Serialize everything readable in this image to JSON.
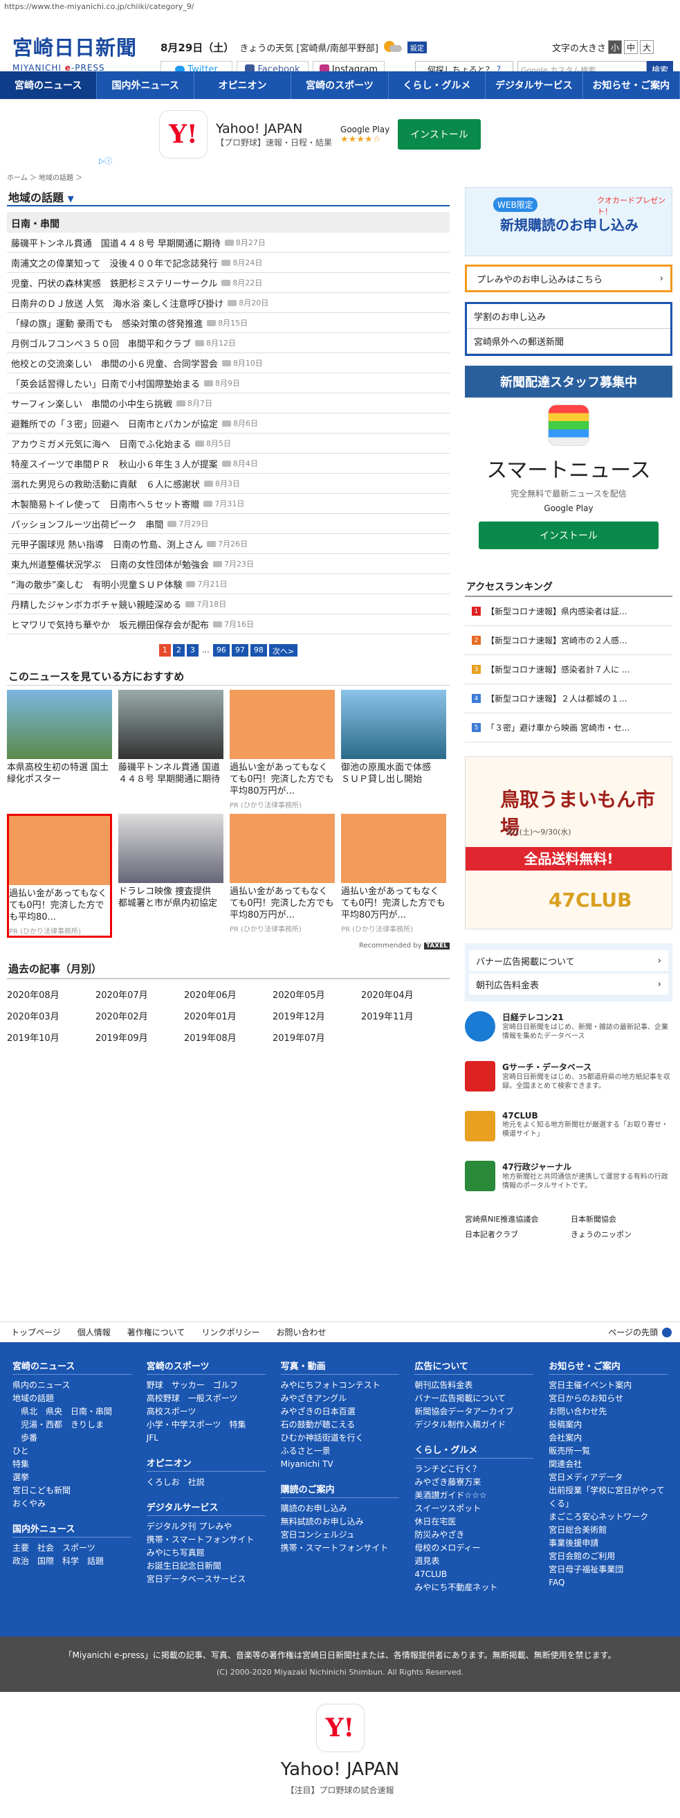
{
  "url": "https://www.the-miyanichi.co.jp/chiiki/category_9/",
  "header": {
    "logo_text": "宮崎日日新聞",
    "logo_sub_a": "MIYANICHI ",
    "logo_sub_b": "e",
    "logo_sub_c": "-PRESS",
    "date": "8月29日（土）",
    "weather_label": "きょうの天気 [宮崎県/南部平野部]",
    "weather_setting": "設定",
    "fontsize_label": "文字の大きさ",
    "fs_small": "小",
    "fs_mid": "中",
    "fs_large": "大",
    "twitter": "Twitter",
    "facebook": "Facebook",
    "instagram": "Instagram",
    "ask": "何探しちょると？",
    "search_placeholder": "Google カスタム検索",
    "search_button": "検索"
  },
  "nav": [
    "宮崎のニュース",
    "国内外ニュース",
    "オピニオン",
    "宮崎のスポーツ",
    "くらし・グルメ",
    "デジタルサービス",
    "お知らせ・ご案内"
  ],
  "top_ad": {
    "title": "Yahoo! JAPAN",
    "desc": "【プロ野球】速報・日程・結果",
    "gplay": "Google Play",
    "stars": "★★★★☆",
    "install": "インストール",
    "logo": "Y!"
  },
  "breadcrumb": "ホーム ＞ 地域の話題 ＞",
  "section_title": "地域の話題",
  "section_sub": "日南・串間",
  "articles": [
    {
      "title": "藤磯平トンネル貫通　国道４４８号 早期開通に期待",
      "date": "8月27日"
    },
    {
      "title": "南浦文之の偉業知って　没後４００年で記念誌発行",
      "date": "8月24日"
    },
    {
      "title": "児童、円状の森林実感　鉄肥杉ミステリーサークル",
      "date": "8月22日"
    },
    {
      "title": "日南弁のＤＪ放送 人気　海水浴 楽しく注意呼び掛け",
      "date": "8月20日"
    },
    {
      "title": "「緑の旗」運動 豪雨でも　感染対策の啓発推進",
      "date": "8月15日"
    },
    {
      "title": "月例ゴルフコンペ３５０回　串間平和クラブ",
      "date": "8月12日"
    },
    {
      "title": "他校との交流楽しい　串間の小６児童、合同学習会",
      "date": "8月10日"
    },
    {
      "title": "「英会話習得したい」日南で小村国際塾始まる",
      "date": "8月9日"
    },
    {
      "title": "サーフィン楽しい　串間の小中生ら挑戦",
      "date": "8月7日"
    },
    {
      "title": "避難所での「３密」回避へ　日南市とパカンが協定",
      "date": "8月6日"
    },
    {
      "title": "アカウミガメ元気に海へ　日南でふ化始まる",
      "date": "8月5日"
    },
    {
      "title": "特産スイーツで串間ＰＲ　秋山小６年生３人が提案",
      "date": "8月4日"
    },
    {
      "title": "溺れた男児らの救助活動に貢献　６人に感謝状",
      "date": "8月3日"
    },
    {
      "title": "木製簡易トイレ使って　日南市へ５セット寄贈",
      "date": "7月31日"
    },
    {
      "title": "パッションフルーツ出荷ピーク　串間",
      "date": "7月29日"
    },
    {
      "title": "元甲子園球児 熱い指導　日南の竹島、渕上さん",
      "date": "7月26日"
    },
    {
      "title": "東九州道整備状況学ぶ　日南の女性団体が勉強会",
      "date": "7月23日"
    },
    {
      "title": "“海の散歩”楽しむ　有明小児童ＳＵＰ体験",
      "date": "7月21日"
    },
    {
      "title": "丹精したジャンボカボチャ競い親睦深める",
      "date": "7月18日"
    },
    {
      "title": "ヒマワリで気持ち華やか　坂元棚田保存会が配布",
      "date": "7月16日"
    }
  ],
  "pager": [
    "1",
    "2",
    "3",
    "…",
    "96",
    "97",
    "98",
    "次へ>"
  ],
  "reco_title": "このニュースを見ている方におすすめ",
  "reco": [
    {
      "text": "本県高校生初の特選 国土緑化ポスター",
      "pr": ""
    },
    {
      "text": "藤磯平トンネル貫通 国道４４８号 早期開通に期待",
      "pr": ""
    },
    {
      "text": "過払い金があってもなくても0円！完済した方でも平均80万円が...",
      "pr": "PR (ひかり法律事務所)"
    },
    {
      "text": "御池の原風水面で体感　ＳＵＰ貸し出し開始",
      "pr": ""
    },
    {
      "text": "過払い金があってもなくても0円！完済した方でも平均80...",
      "pr": "PR (ひかり法律事務所)"
    },
    {
      "text": "ドラレコ映像 捜査提供　都城署と市が県内初協定",
      "pr": ""
    },
    {
      "text": "過払い金があってもなくても0円！完済した方でも平均80万円が...",
      "pr": "PR (ひかり法律事務所)"
    },
    {
      "text": "過払い金があってもなくても0円！完済した方でも平均80万円が...",
      "pr": "PR (ひかり法律事務所)"
    }
  ],
  "recommended_by": "Recommended by",
  "recommended_logo": "TAXEL",
  "archive_title": "過去の記事（月別）",
  "archive": [
    "2020年08月",
    "2020年07月",
    "2020年06月",
    "2020年05月",
    "2020年04月",
    "2020年03月",
    "2020年02月",
    "2020年01月",
    "2019年12月",
    "2019年11月",
    "2019年10月",
    "2019年09月",
    "2019年08月",
    "2019年07月"
  ],
  "side": {
    "subscribe_tag": "WEB限定",
    "subscribe_main": "新規購読のお申し込み",
    "subscribe_gift": "クオカードプレゼント！",
    "premium_link": "プレみやのお申し込みはこちら",
    "box": [
      "学割のお申し込み",
      "宮崎県外への郵送新聞"
    ],
    "staff": "新聞配達スタッフ募集中",
    "smart_title": "スマートニュース",
    "smart_desc": "完全無料で最新ニュースを配信",
    "smart_gplay": "Google Play",
    "smart_install": "インストール",
    "rank_title": "アクセスランキング",
    "rank": [
      "【新型コロナ速報】県内感染者は証...",
      "【新型コロナ速報】宮崎市の２人感...",
      "【新型コロナ速報】感染者計７人に ...",
      "【新型コロナ速報】２人は都城の１...",
      "「３密」避け車から映画 宮崎市・セ..."
    ],
    "ad47_t1": "鳥取うまいもん市場",
    "ad47_t2": "8/1(土)～9/30(水)",
    "ad47_t3": "全品送料無料!",
    "ad47_t4": "47CLUB",
    "adlinks": [
      "バナー広告掲載について",
      "朝刊広告料金表"
    ],
    "svc": [
      {
        "title": "日経テレコン21",
        "desc": "宮崎日日新聞をはじめ、新聞・雑誌の最新記事、企業情報を集めたデータベース"
      },
      {
        "title": "Gサーチ・データベース",
        "desc": "宮崎日日新聞をはじめ、35都道府県の地方紙記事を収録。全国まとめて検索できます。"
      },
      {
        "title": "47CLUB",
        "desc": "地元をよく知る地方新聞社が厳選する「お取り寄せ・横道サイト」"
      },
      {
        "title": "47行政ジャーナル",
        "desc": "地方新聞社と共同通信が連携して運営する有料の行政情報のポータルサイトです。"
      }
    ],
    "footlinks": [
      "宮崎県NIE推進協議会",
      "日本新聞協会",
      "日本記者クラブ",
      "きょうのニッポン"
    ]
  },
  "subfoot": [
    "トップページ",
    "個人情報",
    "著作権について",
    "リンクポリシー",
    "お問い合わせ"
  ],
  "pagetop": "ページの先頭",
  "footer": [
    {
      "groups": [
        {
          "head": "宮崎のニュース",
          "items": [
            "県内のニュース",
            "地域の話題",
            "　県北　県央　日南・串間",
            "　児湯・西都　きりしま",
            "　歩番",
            "ひと",
            "特集",
            "選挙",
            "宮日こども新聞",
            "おくやみ"
          ]
        },
        {
          "head": "国内外ニュース",
          "items": [
            "主要　社会　スポーツ",
            "政治　国際　科学　話題"
          ]
        }
      ]
    },
    {
      "groups": [
        {
          "head": "宮崎のスポーツ",
          "items": [
            "野球　サッカー　ゴルフ",
            "高校野球　一般スポーツ",
            "高校スポーツ",
            "小学・中学スポーツ　特集",
            "JFL"
          ]
        },
        {
          "head": "オピニオン",
          "items": [
            "くろしお　社説"
          ]
        },
        {
          "head": "デジタルサービス",
          "items": [
            "デジタル夕刊 プレみや",
            "携帯・スマートフォンサイト",
            "みやにち写真館",
            "お誕生日記念日新聞",
            "宮日データベースサービス"
          ]
        }
      ]
    },
    {
      "groups": [
        {
          "head": "写真・動画",
          "items": [
            "みやにちフォトコンテスト",
            "みやざきアングル",
            "みやざきの日本百選",
            "石の鼓動が聴こえる",
            "ひむか神話街道を行く",
            "ふるさと一景",
            "Miyanichi TV"
          ]
        },
        {
          "head": "購読のご案内",
          "items": [
            "購読のお申し込み",
            "無料試読のお申し込み",
            "宮日コンシェルジュ",
            "携帯・スマートフォンサイト"
          ]
        }
      ]
    },
    {
      "groups": [
        {
          "head": "広告について",
          "items": [
            "朝刊広告料金表",
            "バナー広告掲載について",
            "新聞協会データアーカイブ",
            "デジタル制作入稿ガイド"
          ]
        },
        {
          "head": "くらし・グルメ",
          "items": [
            "ランチどこ行く？",
            "みやざき藤寮万来",
            "美酒讃ガイド☆☆☆",
            "スイーツスポット",
            "休日在宅医",
            "防災みやざき",
            "母校のメロディー",
            "週見表",
            "47CLUB",
            "みやにち不動産ネット"
          ]
        }
      ]
    },
    {
      "groups": [
        {
          "head": "お知らせ・ご案内",
          "items": [
            "宮日主催イベント案内",
            "宮日からのお知らせ",
            "お問い合わせ先",
            "投稿案内",
            "会社案内",
            "販売所一覧",
            "関連会社",
            "宮日メディアデータ",
            "出前授業「学校に宮日がやってくる」",
            "まごころ安心ネットワーク",
            "宮日総合美術館",
            "事業後援申請",
            "宮日会館のご利用",
            "宮日母子福祉事業団",
            "FAQ"
          ]
        }
      ]
    }
  ],
  "copyright_1": "「Miyanichi e-press」に掲載の記事、写真、音楽等の著作権は宮崎日日新聞社または、各情報提供者にあります。無断掲載、無断使用を禁じます。",
  "copyright_2": "(C) 2000-2020 Miyazaki Nichinichi Shimbun. All Rights Reserved.",
  "bottom_ad": {
    "logo": "Y!",
    "title": "Yahoo! JAPAN",
    "desc": "【注目】プロ野球の試合速報"
  },
  "colors": {
    "brand": "#1a55b0",
    "accent": "#e54b2c"
  }
}
